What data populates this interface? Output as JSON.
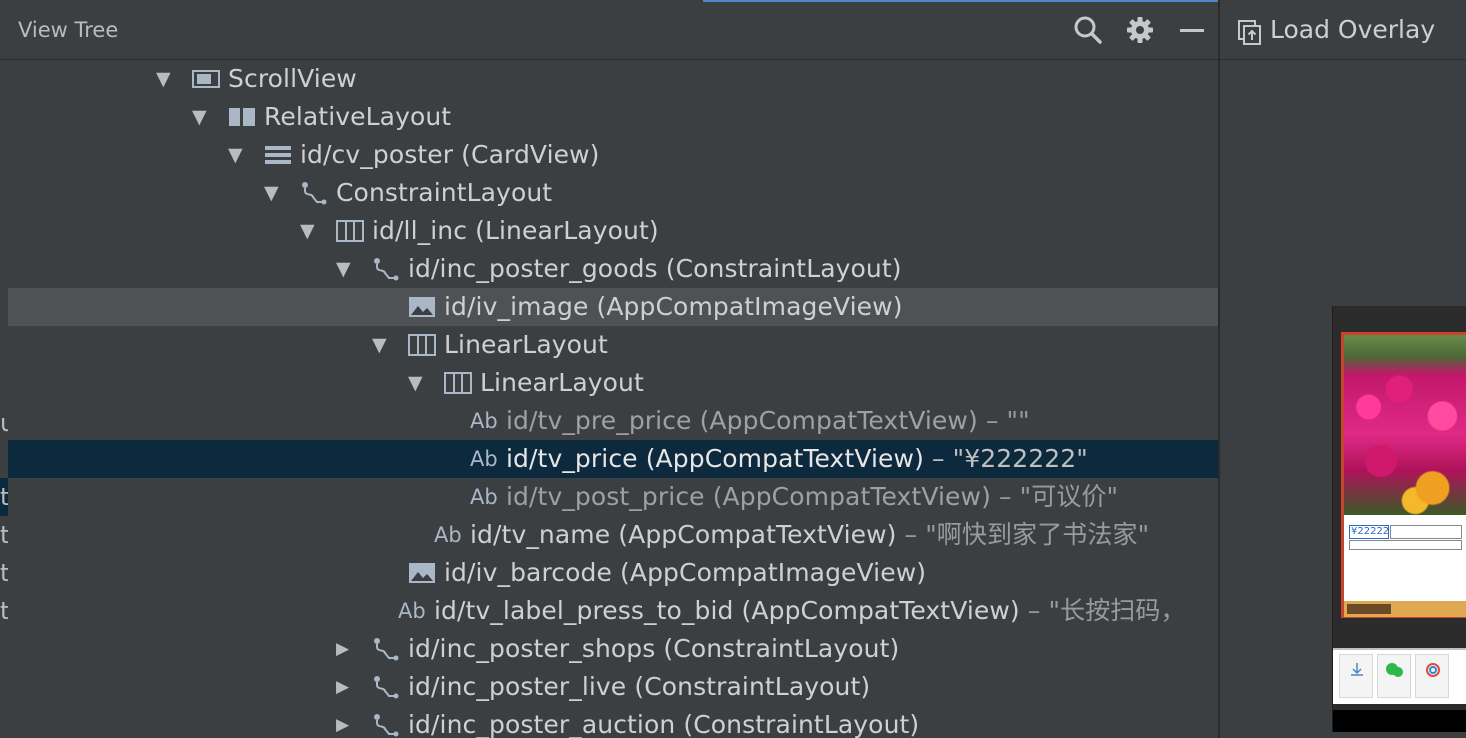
{
  "header": {
    "title": "View Tree"
  },
  "toolbar": {
    "search_icon": "search-icon",
    "settings_icon": "gear-icon",
    "minimize_icon": "minimize-icon"
  },
  "right": {
    "load_overlay_label": "Load Overlay"
  },
  "tree": [
    {
      "level": 0,
      "toggle": "▼",
      "icon": "scroll",
      "text": "ScrollView",
      "suffix": ""
    },
    {
      "level": 1,
      "toggle": "▼",
      "icon": "relative",
      "text": "RelativeLayout",
      "suffix": ""
    },
    {
      "level": 2,
      "toggle": "▼",
      "icon": "card",
      "text": "id/cv_poster (CardView)",
      "suffix": ""
    },
    {
      "level": 3,
      "toggle": "▼",
      "icon": "constraint",
      "text": "ConstraintLayout",
      "suffix": ""
    },
    {
      "level": 4,
      "toggle": "▼",
      "icon": "linear",
      "text": "id/ll_inc (LinearLayout)",
      "suffix": ""
    },
    {
      "level": 5,
      "toggle": "▼",
      "icon": "constraint",
      "text": "id/inc_poster_goods (ConstraintLayout)",
      "suffix": ""
    },
    {
      "level": 6,
      "toggle": "",
      "icon": "image",
      "text": "id/iv_image (AppCompatImageView)",
      "suffix": ""
    },
    {
      "level": 6,
      "toggle": "▼",
      "icon": "linear",
      "text": "LinearLayout",
      "suffix": ""
    },
    {
      "level": 7,
      "toggle": "▼",
      "icon": "linear",
      "text": "LinearLayout",
      "suffix": ""
    },
    {
      "level": 8,
      "toggle": "",
      "icon": "text",
      "text": "id/tv_pre_price (AppCompatTextView)",
      "suffix": " – \"\""
    },
    {
      "level": 8,
      "toggle": "",
      "icon": "text",
      "text": "id/tv_price (AppCompatTextView)",
      "suffix": " – \"¥222222\""
    },
    {
      "level": 8,
      "toggle": "",
      "icon": "text",
      "text": "id/tv_post_price (AppCompatTextView)",
      "suffix": " – \"可议价\""
    },
    {
      "level": 7,
      "toggle": "",
      "icon": "text",
      "text": "id/tv_name (AppCompatTextView)",
      "suffix": " – \"啊快到家了书法家\""
    },
    {
      "level": 6,
      "toggle": "",
      "icon": "image",
      "text": "id/iv_barcode (AppCompatImageView)",
      "suffix": ""
    },
    {
      "level": 6,
      "toggle": "",
      "icon": "text",
      "text": "id/tv_label_press_to_bid (AppCompatTextView)",
      "suffix": " – \"长按扫码，"
    },
    {
      "level": 5,
      "toggle": "▶",
      "icon": "constraint",
      "text": "id/inc_poster_shops (ConstraintLayout)",
      "suffix": ""
    },
    {
      "level": 5,
      "toggle": "▶",
      "icon": "constraint",
      "text": "id/inc_poster_live (ConstraintLayout)",
      "suffix": ""
    },
    {
      "level": 5,
      "toggle": "▶",
      "icon": "constraint",
      "text": "id/inc_poster_auction (ConstraintLayout)",
      "suffix": ""
    }
  ],
  "selected_index": 10,
  "hover_index": 6,
  "preview": {
    "price": "¥222222"
  },
  "colors": {
    "background": "#3c3f41",
    "selection": "#0d293e",
    "hover": "#4e5254",
    "accent": "#4a88c7"
  }
}
